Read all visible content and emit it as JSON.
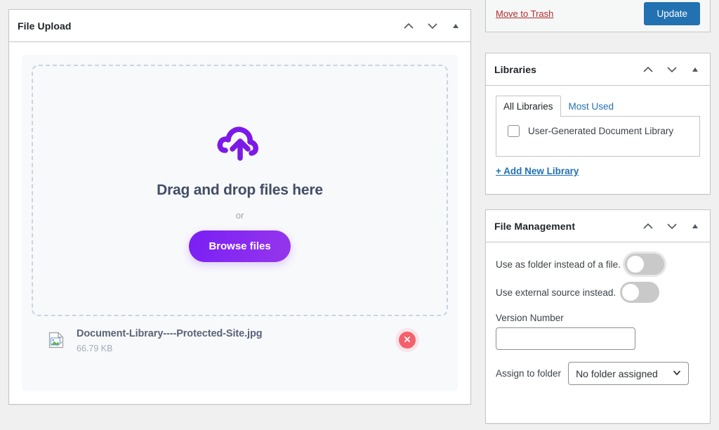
{
  "file_upload": {
    "title": "File Upload",
    "dropzone": {
      "icon": "cloud-upload-icon",
      "title": "Drag and drop files here",
      "or_text": "or",
      "browse_label": "Browse files"
    },
    "files": [
      {
        "icon": "broken-image-icon",
        "name": "Document-Library----Protected-Site.jpg",
        "size": "66.79 KB",
        "remove_icon": "close-circle-icon"
      }
    ],
    "header_icons": [
      "chevron-up-icon",
      "chevron-down-icon",
      "collapse-triangle-icon"
    ]
  },
  "submit_box": {
    "trash_label": "Move to Trash",
    "update_label": "Update"
  },
  "libraries": {
    "title": "Libraries",
    "tabs": [
      {
        "label": "All Libraries",
        "active": true
      },
      {
        "label": "Most Used",
        "active": false
      }
    ],
    "items": [
      {
        "label": "User-Generated Document Library",
        "checked": false
      }
    ],
    "add_new_label": "+ Add New Library"
  },
  "file_management": {
    "title": "File Management",
    "toggles": [
      {
        "label": "Use as folder instead of a file.",
        "on": false
      },
      {
        "label": "Use external source instead.",
        "on": false
      }
    ],
    "version_number": {
      "label": "Version Number",
      "value": "",
      "placeholder": ""
    },
    "assign_folder": {
      "label": "Assign to folder",
      "selected": "No folder assigned"
    }
  },
  "colors": {
    "accent_purple": "#7a1ff5",
    "wp_blue": "#2271b1",
    "trash_red": "#b32d2e",
    "remove_red": "#f4606b",
    "page_bg": "#f0f0f1"
  }
}
